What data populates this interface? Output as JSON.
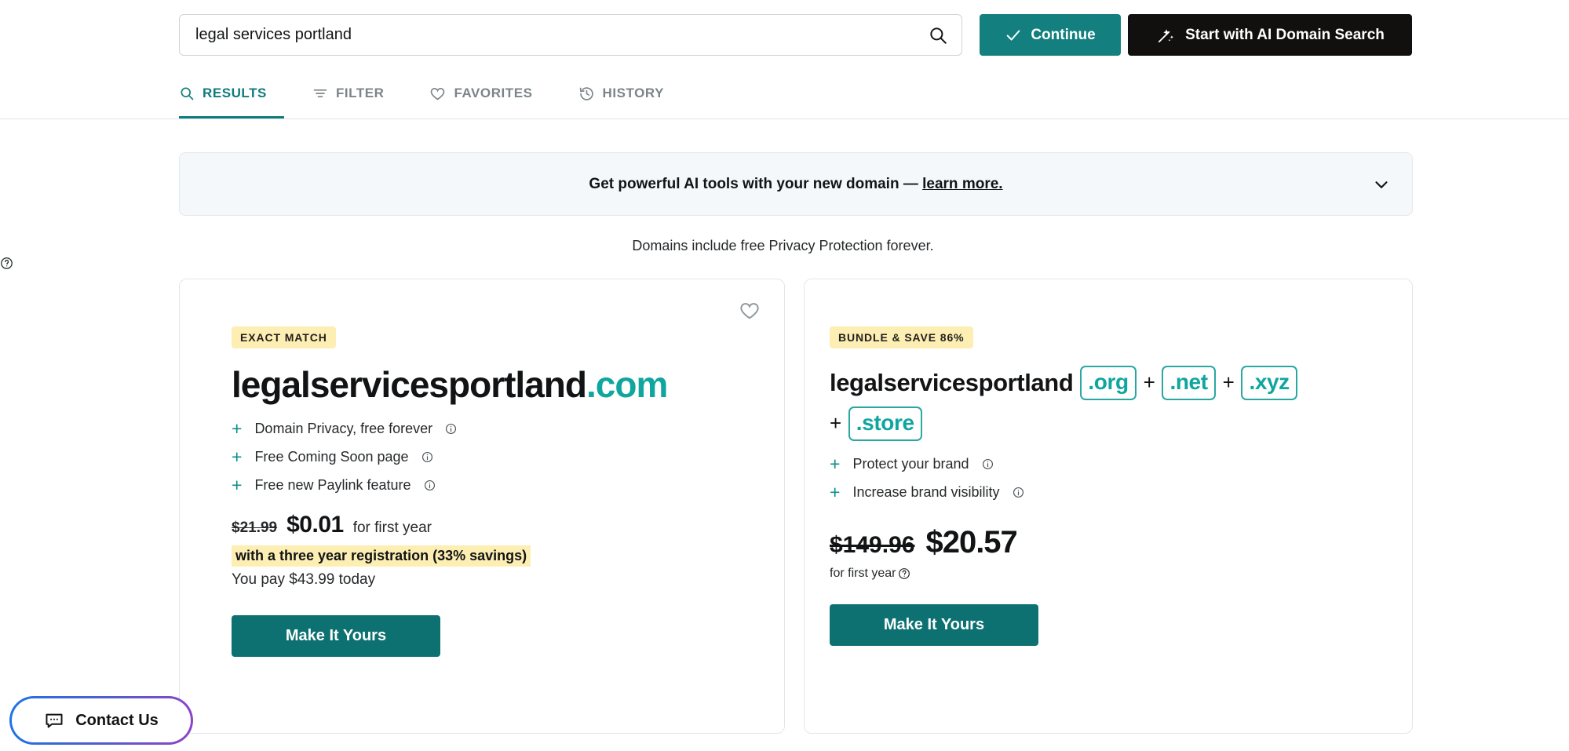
{
  "search": {
    "value": "legal services portland",
    "placeholder": "Search for a domain",
    "icon": "search-icon"
  },
  "header": {
    "continue_label": "Continue",
    "ai_search_label": "Start with AI Domain Search",
    "accent_teal": "#137f7f",
    "black": "#12100e"
  },
  "tabs": [
    {
      "label": "RESULTS",
      "icon": "search-icon",
      "active": true
    },
    {
      "label": "FILTER",
      "icon": "filter-icon",
      "active": false
    },
    {
      "label": "FAVORITES",
      "icon": "heart-icon",
      "active": false
    },
    {
      "label": "HISTORY",
      "icon": "history-icon",
      "active": false
    }
  ],
  "promo": {
    "text": "Get powerful AI tools with your new domain — ",
    "link": "learn more.",
    "chevron": "chevron-down-icon"
  },
  "privacy_note": {
    "text": "Domains include free Privacy Protection forever.",
    "icon": "question-circle-icon"
  },
  "cards": {
    "left": {
      "badge": "EXACT MATCH",
      "favorite_icon": "heart-icon",
      "domain_name": "legalservicesportland",
      "domain_tld": ".com",
      "features": [
        {
          "label": "Domain Privacy, free forever",
          "icon": "info-icon"
        },
        {
          "label": "Free Coming Soon page",
          "icon": "info-icon"
        },
        {
          "label": "Free new Paylink feature",
          "icon": "info-icon"
        }
      ],
      "price_old": "$21.99",
      "price_new": "$0.01",
      "price_term": "for first year",
      "savings": "with a three year registration (33% savings)",
      "pay_today": "You pay $43.99 today",
      "cta": "Make It Yours"
    },
    "right": {
      "badge": "BUNDLE & SAVE 86%",
      "domain_name": "legalservicesportland",
      "tlds": [
        ".org",
        ".net",
        ".xyz",
        ".store"
      ],
      "separator": "+",
      "features": [
        {
          "label": "Protect your brand",
          "icon": "info-icon"
        },
        {
          "label": "Increase brand visibility",
          "icon": "info-icon"
        }
      ],
      "price_old": "$149.96",
      "price_new": "$20.57",
      "price_term": "for first year",
      "price_term_icon": "question-circle-icon",
      "cta": "Make It Yours"
    }
  },
  "contact": {
    "label": "Contact Us",
    "icon": "chat-bubble-icon"
  }
}
